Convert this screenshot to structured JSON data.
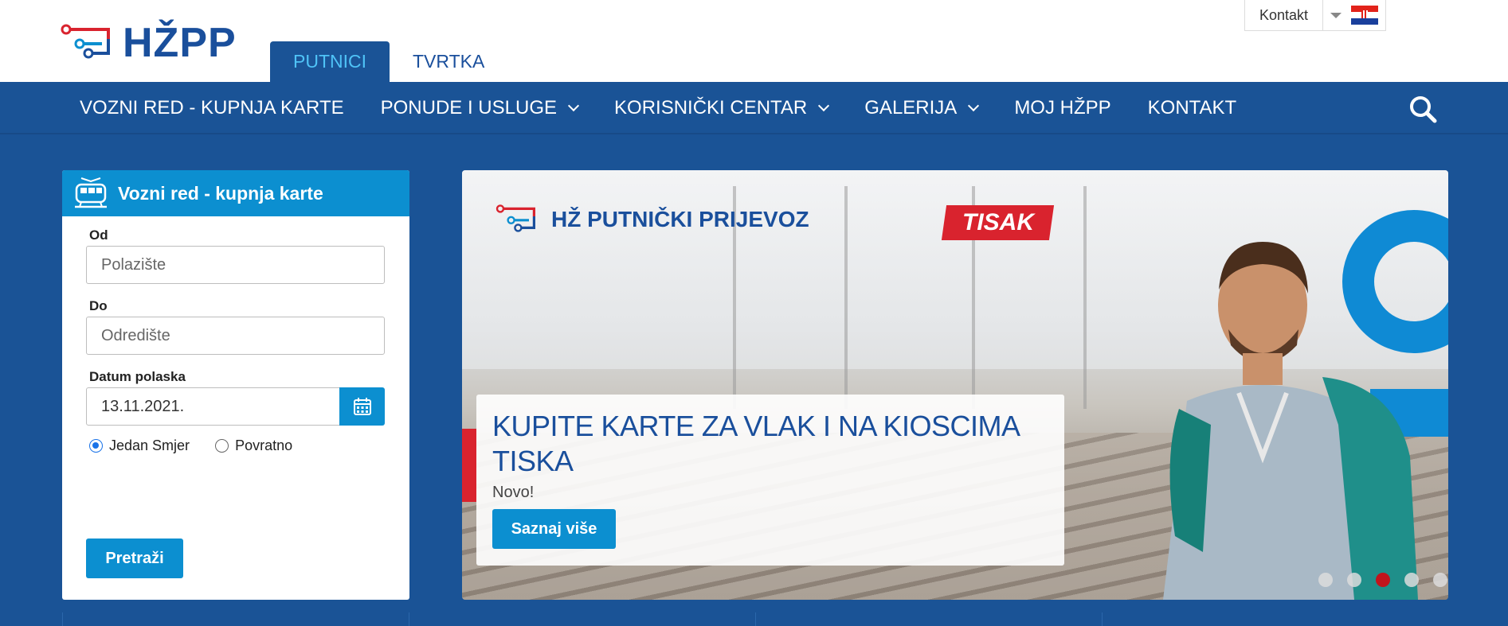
{
  "header": {
    "logo_text": "HŽPP",
    "segment_tabs": [
      {
        "label": "PUTNICI",
        "active": true
      },
      {
        "label": "TVRTKA",
        "active": false
      }
    ],
    "utility": {
      "contact_label": "Kontakt",
      "language_flag": "croatia-flag-icon"
    }
  },
  "nav": {
    "items": [
      {
        "label": "VOZNI RED - KUPNJA KARTE",
        "has_dropdown": false
      },
      {
        "label": "PONUDE I USLUGE",
        "has_dropdown": true
      },
      {
        "label": "KORISNIČKI CENTAR",
        "has_dropdown": true
      },
      {
        "label": "GALERIJA",
        "has_dropdown": true
      },
      {
        "label": "MOJ HŽPP",
        "has_dropdown": false
      },
      {
        "label": "KONTAKT",
        "has_dropdown": false
      }
    ],
    "search_icon": "search-icon"
  },
  "booking": {
    "title": "Vozni red - kupnja karte",
    "icon": "train-icon",
    "from_label": "Od",
    "from_placeholder": "Polazište",
    "to_label": "Do",
    "to_placeholder": "Odredište",
    "date_label": "Datum polaska",
    "date_value": "13.11.2021.",
    "calendar_icon": "calendar-icon",
    "radio_one_way": "Jedan Smjer",
    "radio_return": "Povratno",
    "selected_trip": "Jedan Smjer",
    "submit_label": "Pretraži"
  },
  "hero": {
    "brand_text": "HŽ PUTNIČKI PRIJEVOZ",
    "partner_logo": "TISAK",
    "headline": "KUPITE KARTE ZA VLAK I NA KIOSCIMA TISKA",
    "subtitle": "Novo!",
    "cta_label": "Saznaj više",
    "slide_count": 5,
    "active_slide": 3
  },
  "colors": {
    "brand_blue": "#1a5396",
    "accent_blue": "#0c8fd0",
    "active_tab_text": "#4fc3f7",
    "red": "#d9232e"
  }
}
